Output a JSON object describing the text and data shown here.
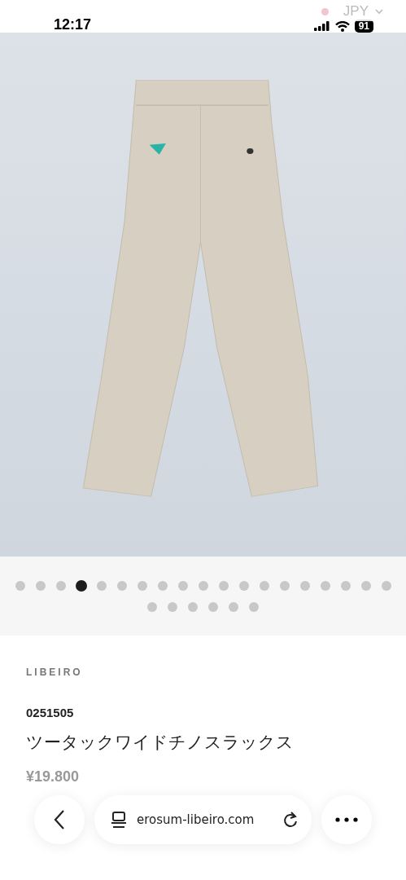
{
  "status_bar": {
    "time": "12:17",
    "battery": "91"
  },
  "currency": {
    "label": "JPY"
  },
  "gallery": {
    "dots": [
      {
        "selected": false
      },
      {
        "selected": false
      },
      {
        "selected": false
      },
      {
        "selected": true
      },
      {
        "selected": false
      },
      {
        "selected": false
      },
      {
        "selected": false
      },
      {
        "selected": false
      },
      {
        "selected": false
      },
      {
        "selected": false
      },
      {
        "selected": false
      },
      {
        "selected": false
      },
      {
        "selected": false
      },
      {
        "selected": false
      },
      {
        "selected": false
      },
      {
        "selected": false
      },
      {
        "selected": false
      },
      {
        "selected": false
      },
      {
        "selected": false
      },
      {
        "selected": false
      },
      {
        "selected": false
      },
      {
        "selected": false
      },
      {
        "selected": false
      },
      {
        "selected": false
      },
      {
        "selected": false
      }
    ]
  },
  "product": {
    "brand": "LIBEIRO",
    "code": "0251505",
    "name": "ツータックワイドチノスラックス",
    "price": "¥19.800"
  },
  "browser_bar": {
    "url": "erosum-libeiro.com"
  }
}
